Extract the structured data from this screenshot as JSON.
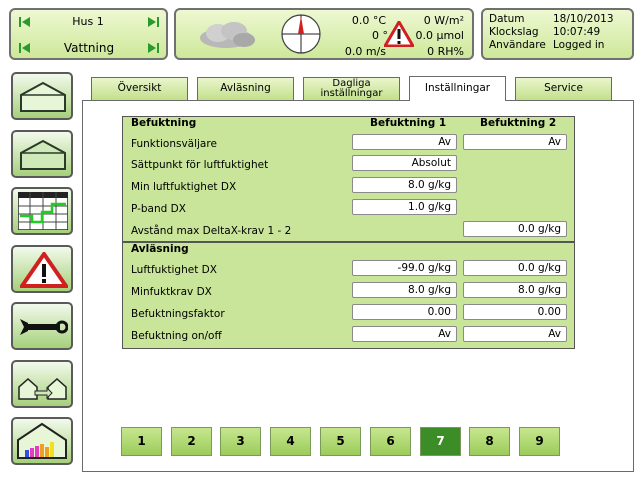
{
  "header": {
    "house": "Hus 1",
    "mode": "Vattning",
    "weather": {
      "temp1": "0.0 °C",
      "temp2": "0 °",
      "wind": "0.0 m/s",
      "radiation": "0 W/m²",
      "co2": "0.0 µmol",
      "humidity": "0 RH%"
    },
    "info": {
      "date_label": "Datum",
      "date_value": "18/10/2013",
      "time_label": "Klockslag",
      "time_value": "10:07:49",
      "user_label": "Användare",
      "user_value": "Logged in"
    }
  },
  "tabs": [
    {
      "label": "Översikt"
    },
    {
      "label": "Avläsning"
    },
    {
      "label": "Dagliga",
      "label2": "inställningar"
    },
    {
      "label": "Inställningar"
    },
    {
      "label": "Service"
    }
  ],
  "settings": {
    "section_title": "Befuktning",
    "col1": "Befuktning 1",
    "col2": "Befuktning 2",
    "rows": [
      {
        "label": "Funktionsväljare",
        "v1": "Av",
        "v2": "Av"
      },
      {
        "label": "Sättpunkt för luftfuktighet",
        "v1": "Absolut"
      },
      {
        "label": "Min luftfuktighet DX",
        "v1": "8.0  g/kg"
      },
      {
        "label": "P-band DX",
        "v1": "1.0  g/kg"
      },
      {
        "label": "Avstånd max DeltaX-krav 1 - 2",
        "v2": "0.0  g/kg"
      }
    ]
  },
  "reading": {
    "section_title": "Avläsning",
    "rows": [
      {
        "label": "Luftfuktighet DX",
        "v1": "-99.0  g/kg",
        "v2": "0.0  g/kg"
      },
      {
        "label": "Minfuktkrav DX",
        "v1": "8.0  g/kg",
        "v2": "8.0  g/kg"
      },
      {
        "label": "Befuktningsfaktor",
        "v1": "0.00",
        "v2": "0.00"
      },
      {
        "label": "Befuktning on/off",
        "v1": "Av",
        "v2": "Av"
      }
    ]
  },
  "pages": [
    "1",
    "2",
    "3",
    "4",
    "5",
    "6",
    "7",
    "8",
    "9"
  ],
  "active_page": "7",
  "colors": {
    "accent": "#3c8c28",
    "panel": "#c9e59a",
    "warning": "#d02020"
  }
}
